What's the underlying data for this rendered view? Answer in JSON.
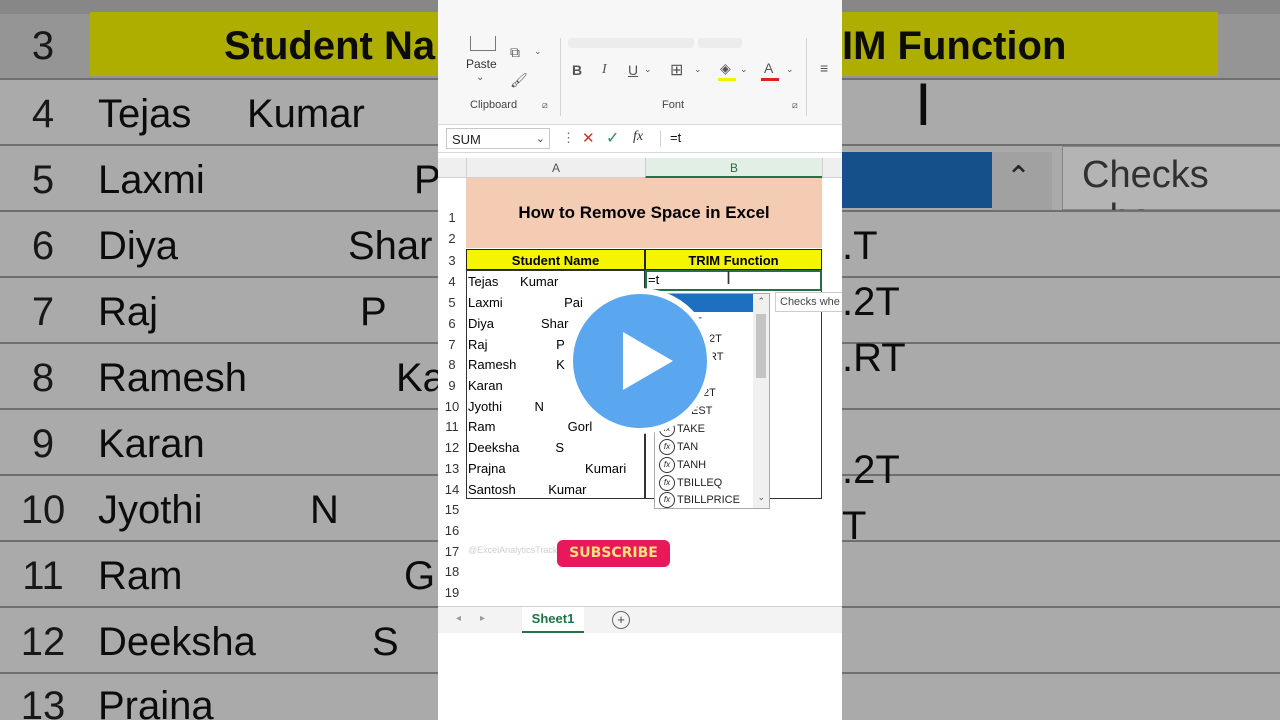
{
  "background": {
    "header_left": "Student Na",
    "header_right": "IM Function",
    "row_numbers": [
      "3",
      "4",
      "5",
      "6",
      "7",
      "8",
      "9",
      "10",
      "11",
      "12",
      "13"
    ],
    "names": [
      "Tejas     Kumar",
      "Laxmi",
      "Diya",
      "Raj",
      "Ramesh",
      "Karan",
      "Jyothi",
      "Ram",
      "Deeksha",
      "Praina"
    ],
    "name_fragments": [
      "P",
      "Shar",
      "P",
      "Ka",
      "",
      "N",
      "G",
      "S",
      ""
    ],
    "tooltip_text": "Checks whe",
    "right_fragments": [
      ".T",
      ".2T",
      ".RT",
      ".2T",
      "T"
    ]
  },
  "ribbon": {
    "paste_label": "Paste",
    "clipboard_label": "Clipboard",
    "font_label": "Font",
    "bold": "B",
    "italic": "I",
    "underline": "U"
  },
  "formula_bar": {
    "name_box": "SUM",
    "cancel": "✕",
    "enter": "✓",
    "fx": "fx",
    "formula": "=t"
  },
  "sheet": {
    "col_a": "A",
    "col_b": "B",
    "title": "How to Remove Space in Excel",
    "header_a": "Student Name",
    "header_b": "TRIM Function",
    "active_cell_value": "=t",
    "row_numbers": [
      "1",
      "2",
      "3",
      "4",
      "5",
      "6",
      "7",
      "8",
      "9",
      "10",
      "11",
      "12",
      "13",
      "14",
      "15",
      "16",
      "17",
      "18",
      "19"
    ],
    "names": [
      "Tejas      Kumar",
      "Laxmi                 Pai",
      "Diya             Shar",
      "Raj                   P",
      "Ramesh           K",
      "Karan",
      "Jyothi         N",
      "Ram                    Gorl",
      "Deeksha          S",
      "Prajna                      Kumari",
      "Santosh         Kumar"
    ],
    "tooltip": "Checks whe",
    "watermark": "@ExcelAnalyticsTrack"
  },
  "autocomplete": {
    "partial": [
      "T",
      "2T",
      "RT",
      "2T",
      "EST"
    ],
    "items": [
      "TAKE",
      "TAN",
      "TANH",
      "TBILLEQ",
      "TBILLPRICE"
    ]
  },
  "sheet_tabs": {
    "active": "Sheet1",
    "add": "+"
  },
  "overlay": {
    "subscribe": "SUBSCRIBE"
  }
}
